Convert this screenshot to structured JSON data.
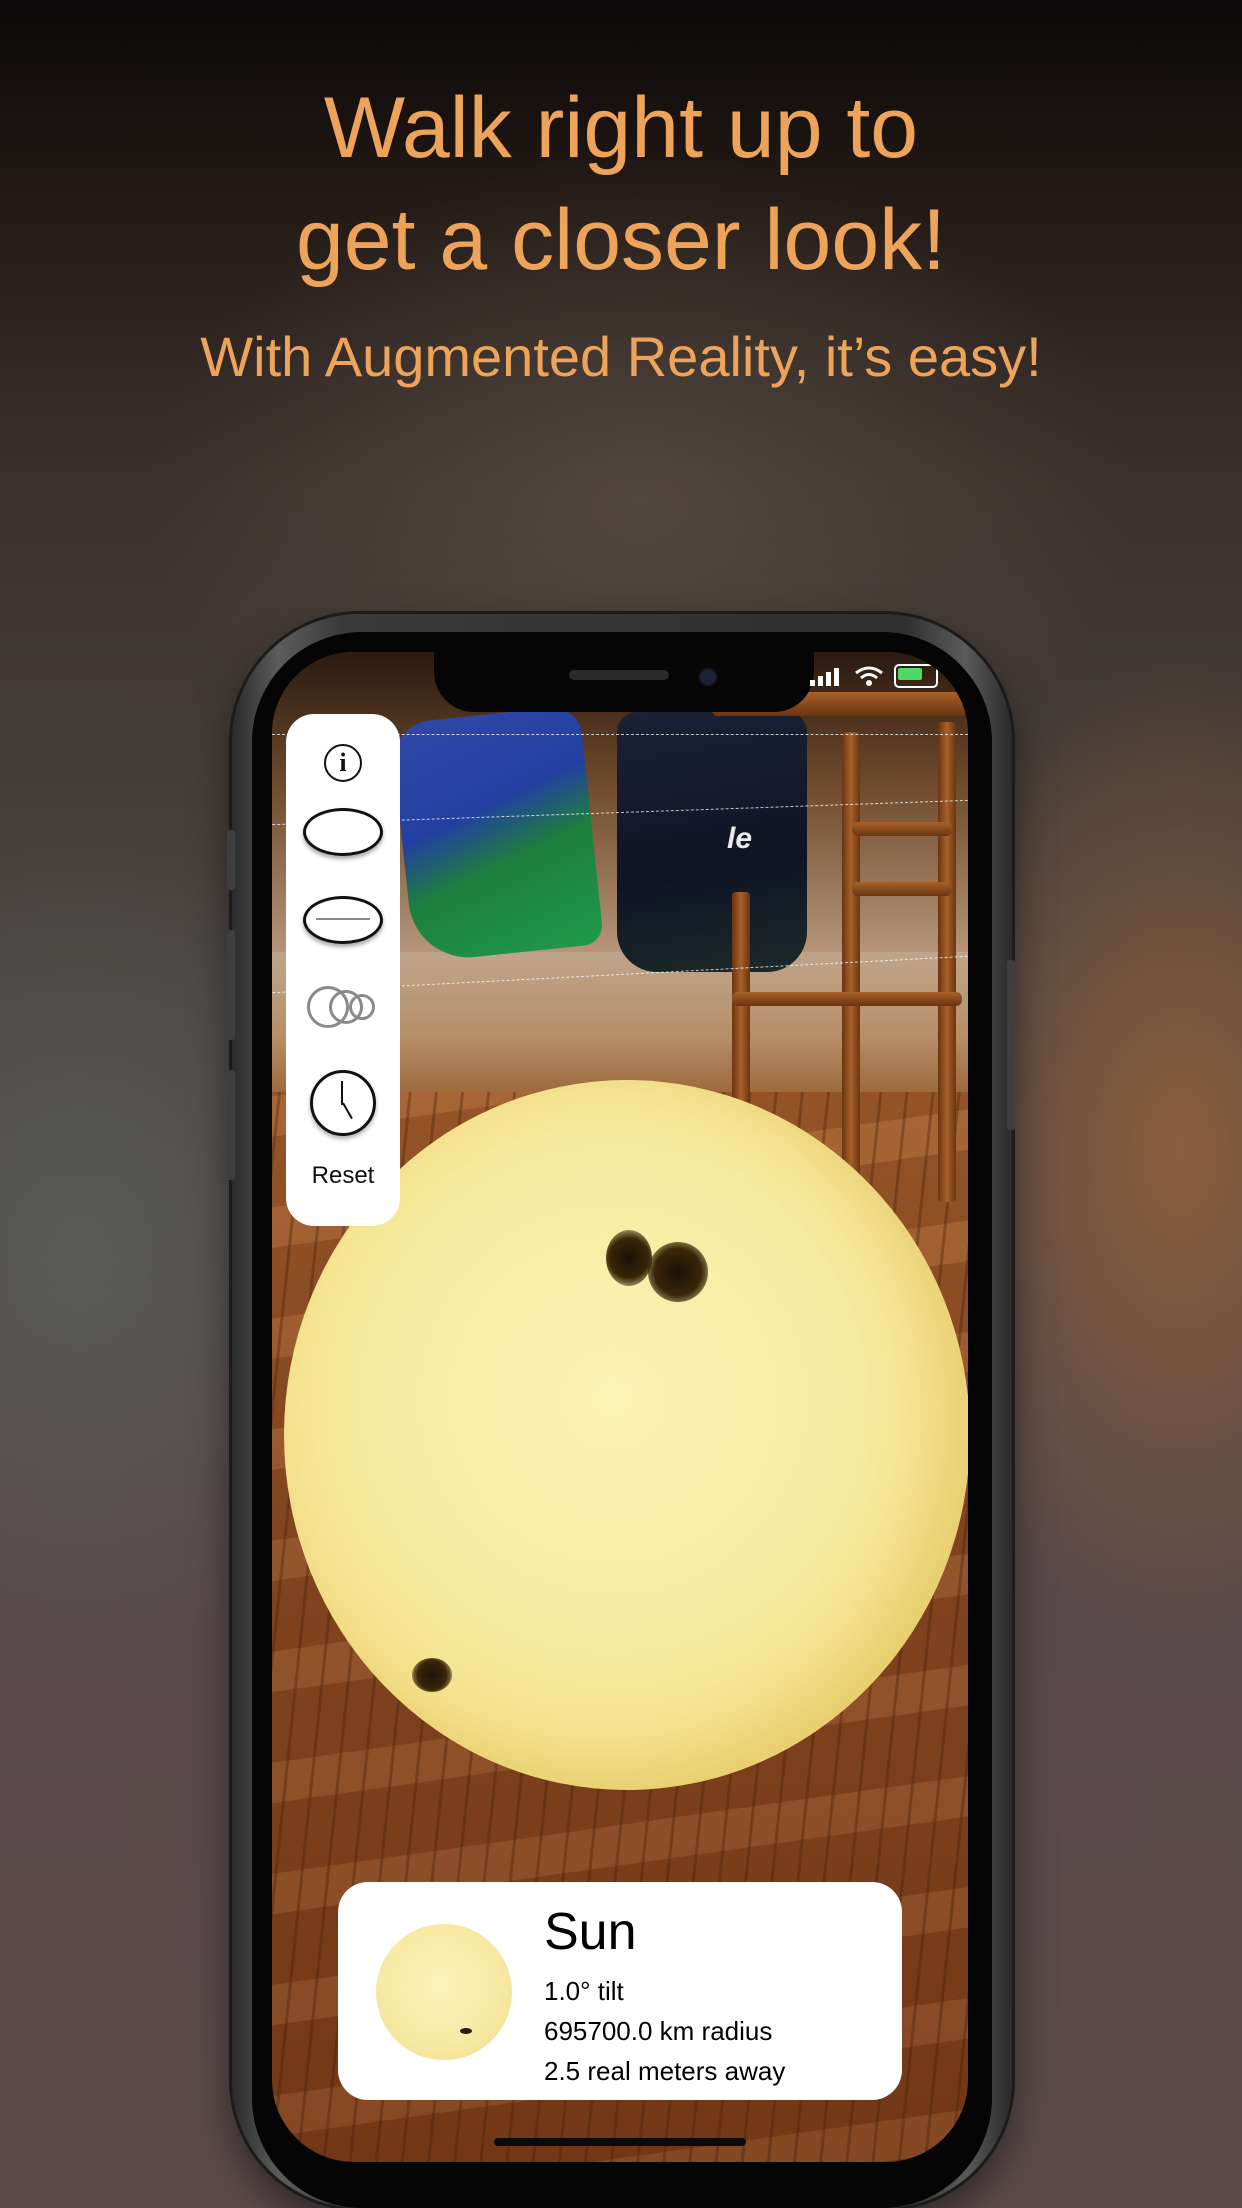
{
  "headline": {
    "line1": "Walk right up to",
    "line2": "get a closer look!"
  },
  "subheadline": "With Augmented Reality, it’s easy!",
  "scene": {
    "bag_logo": "le"
  },
  "controls": {
    "info_icon": "i",
    "reset_label": "Reset"
  },
  "info_card": {
    "title": "Sun",
    "tilt": "1.0° tilt",
    "radius": "695700.0 km radius",
    "distance": "2.5 real meters away"
  },
  "colors": {
    "headline": "#eea35a",
    "sun": "#f8eba0",
    "battery": "#4cd964"
  }
}
